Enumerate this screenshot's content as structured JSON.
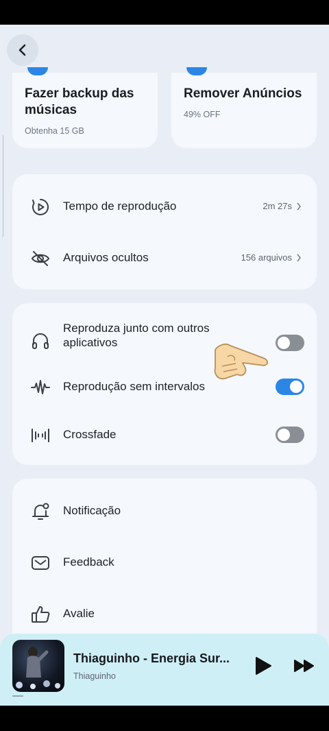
{
  "header": {
    "back_icon": "chevron-left-icon"
  },
  "promos": [
    {
      "title": "Fazer backup das músicas",
      "subtitle": "Obtenha 15 GB"
    },
    {
      "title": "Remover Anúncios",
      "subtitle": "49% OFF"
    }
  ],
  "info_rows": [
    {
      "label": "Tempo de reprodução",
      "value": "2m 27s",
      "icon": "play-timer-icon"
    },
    {
      "label": "Arquivos ocultos",
      "value": "156 arquivos",
      "icon": "eye-off-icon"
    }
  ],
  "toggle_rows": [
    {
      "label": "Reproduza junto com outros aplicativos",
      "state": false,
      "icon": "headphones-icon"
    },
    {
      "label": "Reprodução sem intervalos",
      "state": true,
      "icon": "waveform-icon"
    },
    {
      "label": "Crossfade",
      "state": false,
      "icon": "crossfade-bars-icon"
    }
  ],
  "misc_rows": [
    {
      "label": "Notificação",
      "icon": "bell-icon"
    },
    {
      "label": "Feedback",
      "icon": "mail-icon"
    },
    {
      "label": "Avalie",
      "icon": "thumbs-up-icon"
    }
  ],
  "player": {
    "title": "Thiaguinho - Energia Sur...",
    "artist": "Thiaguinho",
    "play_icon": "play-icon",
    "next_icon": "fast-forward-icon"
  },
  "colors": {
    "accent": "#2b86e6",
    "background": "#e9eef6",
    "card": "#f5f8fc",
    "player": "#cfeff6"
  }
}
